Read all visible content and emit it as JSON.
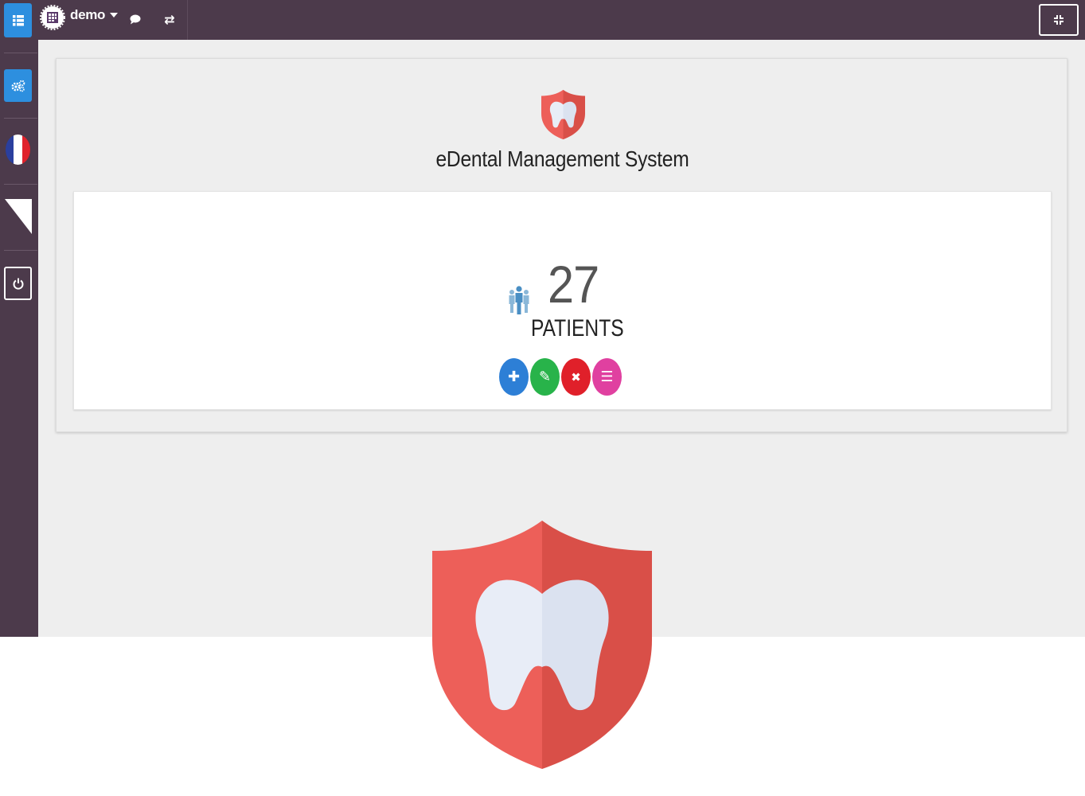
{
  "topbar": {
    "app_name": "demo",
    "switch_glyph": "⇄"
  },
  "sidebar": {
    "items": [
      "grid-menu-icon",
      "settings-cogs-icon",
      "france-flag-icon",
      "corner-triangle-icon",
      "power-icon"
    ]
  },
  "main": {
    "title": "eDental Management System",
    "stats": {
      "count": "27",
      "label": "PATIENTS"
    },
    "actions": [
      {
        "icon": "plus-icon",
        "glyph": "✚",
        "color": "#2d7fd6"
      },
      {
        "icon": "edit-icon",
        "glyph": "✎",
        "color": "#28b34a"
      },
      {
        "icon": "delete-icon",
        "glyph": "✖",
        "color": "#e0202a"
      },
      {
        "icon": "list-icon",
        "glyph": "☰",
        "color": "#e040a0"
      }
    ]
  },
  "colors": {
    "topbar": "#4c3a4b",
    "accent": "#2d8fdf",
    "shield_left": "#ed5f59",
    "shield_right": "#d94f48",
    "tooth": "#e8edf7"
  }
}
